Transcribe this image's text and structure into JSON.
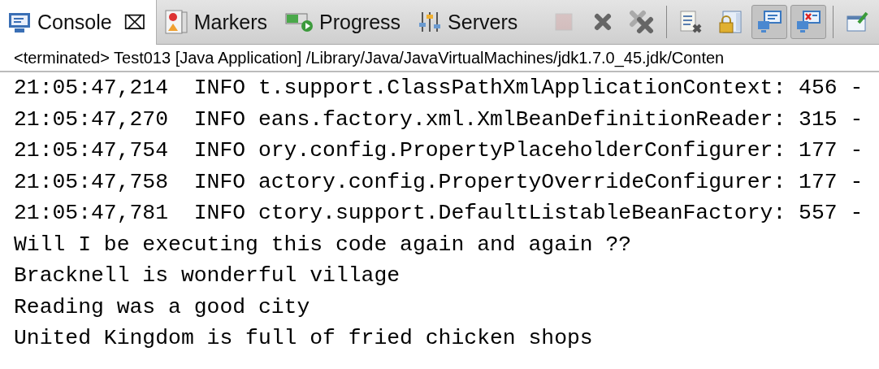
{
  "tabs": [
    {
      "label": "Console",
      "kind": "console",
      "selected": true,
      "close": "⌧"
    },
    {
      "label": "Markers",
      "kind": "markers",
      "selected": false
    },
    {
      "label": "Progress",
      "kind": "progress",
      "selected": false
    },
    {
      "label": "Servers",
      "kind": "servers",
      "selected": false
    }
  ],
  "toolbar": [
    {
      "kind": "terminate",
      "disabled": true,
      "pressed": false
    },
    {
      "kind": "remove-launch",
      "disabled": false,
      "pressed": false
    },
    {
      "kind": "remove-all",
      "disabled": false,
      "pressed": false
    },
    {
      "kind": "separator"
    },
    {
      "kind": "clear",
      "disabled": false,
      "pressed": false
    },
    {
      "kind": "scroll-lock",
      "disabled": false,
      "pressed": false
    },
    {
      "kind": "show-stdout",
      "disabled": false,
      "pressed": true
    },
    {
      "kind": "show-stderr",
      "disabled": false,
      "pressed": true
    },
    {
      "kind": "separator"
    },
    {
      "kind": "pin",
      "disabled": false,
      "pressed": false
    }
  ],
  "process_label": "<terminated> Test013 [Java Application] /Library/Java/JavaVirtualMachines/jdk1.7.0_45.jdk/Conten",
  "console_lines": [
    "21:05:47,214  INFO t.support.ClassPathXmlApplicationContext: 456 -",
    "21:05:47,270  INFO eans.factory.xml.XmlBeanDefinitionReader: 315 -",
    "21:05:47,754  INFO ory.config.PropertyPlaceholderConfigurer: 177 -",
    "21:05:47,758  INFO actory.config.PropertyOverrideConfigurer: 177 -",
    "21:05:47,781  INFO ctory.support.DefaultListableBeanFactory: 557 -",
    "Will I be executing this code again and again ??",
    "Bracknell is wonderful village",
    "Reading was a good city",
    "United Kingdom is full of fried chicken shops"
  ]
}
